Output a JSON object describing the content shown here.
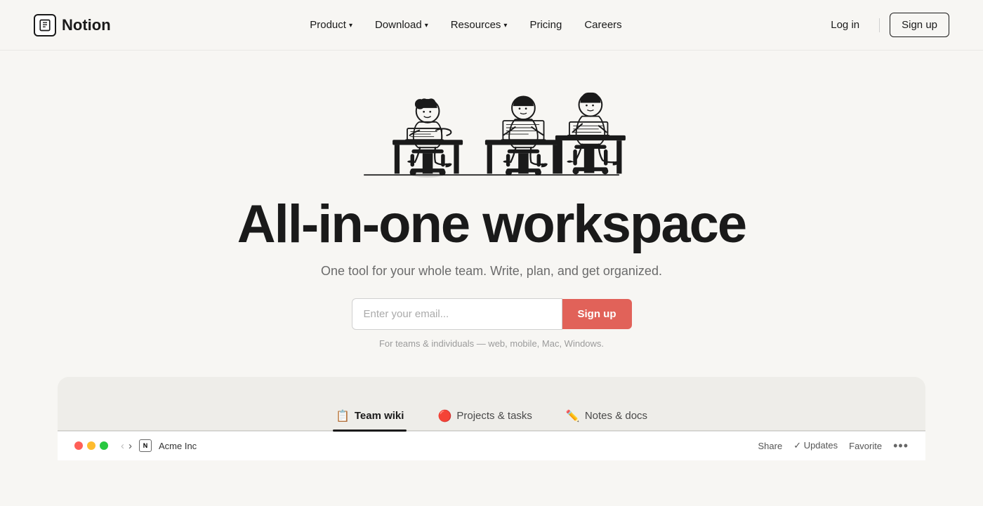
{
  "nav": {
    "logo_text": "Notion",
    "logo_letter": "N",
    "items": [
      {
        "label": "Product",
        "has_dropdown": true
      },
      {
        "label": "Download",
        "has_dropdown": true
      },
      {
        "label": "Resources",
        "has_dropdown": true
      },
      {
        "label": "Pricing",
        "has_dropdown": false
      },
      {
        "label": "Careers",
        "has_dropdown": false
      }
    ],
    "login_label": "Log in",
    "signup_label": "Sign up"
  },
  "hero": {
    "title": "All-in-one workspace",
    "subtitle": "One tool for your whole team. Write, plan, and get organized.",
    "email_placeholder": "Enter your email...",
    "signup_btn": "Sign up",
    "note": "For teams & individuals — web, mobile, Mac, Windows."
  },
  "tabs": [
    {
      "emoji": "📋",
      "label": "Team wiki",
      "active": true
    },
    {
      "emoji": "🔴",
      "label": "Projects & tasks",
      "active": false
    },
    {
      "emoji": "✏️",
      "label": "Notes & docs",
      "active": false
    }
  ],
  "bottom_bar": {
    "title": "Acme Inc",
    "actions": [
      "Share",
      "✓ Updates",
      "Favorite",
      "•••"
    ]
  },
  "colors": {
    "brand_red": "#e16259",
    "background": "#f7f6f3",
    "preview_bg": "#eeede9"
  }
}
